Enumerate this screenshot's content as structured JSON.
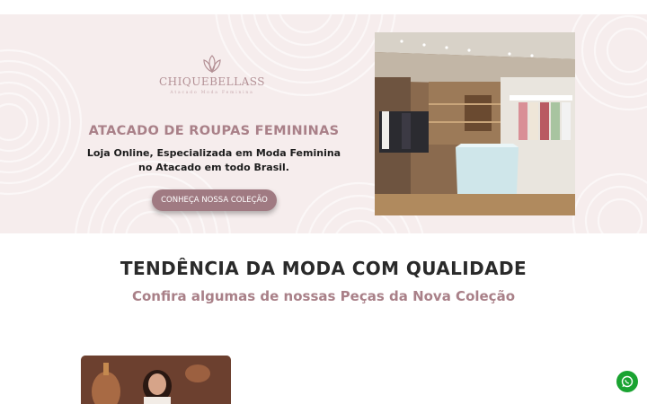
{
  "brand": {
    "name": "CHIQUEBELLASS",
    "tagline": "Atacado Moda Feminina",
    "accent_color": "#a98088",
    "button_color": "#a07a82"
  },
  "hero": {
    "title": "ATACADO DE ROUPAS FEMININAS",
    "subtitle": "Loja Online, Especializada em Moda Feminina no Atacado em todo Brasil.",
    "cta_label": "CONHEÇA NOSSA COLEÇÃO",
    "image": "store-interior-photo"
  },
  "section": {
    "title": "TENDÊNCIA DA MODA COM QUALIDADE",
    "subtitle": "Confira algumas de nossas Peças da Nova Coleção"
  },
  "products": [
    {
      "image": "model-photo"
    }
  ],
  "floating": {
    "whatsapp_icon": "whatsapp-icon",
    "whatsapp_color": "#1aa331"
  }
}
